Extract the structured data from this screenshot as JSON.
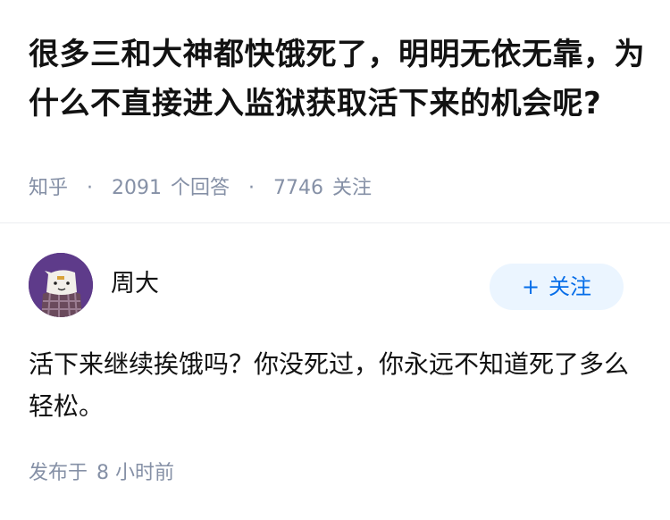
{
  "question": {
    "title": "很多三和大神都快饿死了，明明无依无靠，为什么不直接进入监狱获取活下来的机会呢?",
    "site": "知乎",
    "separator": "·",
    "answer_count": "2091",
    "answer_count_label": "个回答",
    "follower_count": "7746",
    "follower_count_label": "关注"
  },
  "answer": {
    "author_name": "周大",
    "follow_plus": "+",
    "follow_label": "关注",
    "content": "活下来继续挨饿吗？你没死过，你永远不知道死了多么轻松。",
    "time_prefix": "发布于",
    "time_value": "8 小时前"
  },
  "colors": {
    "accent": "#056de8",
    "follow_bg": "#ebf5ff",
    "meta_text": "#8590a6",
    "avatar_bg": "#5e3b8a"
  }
}
